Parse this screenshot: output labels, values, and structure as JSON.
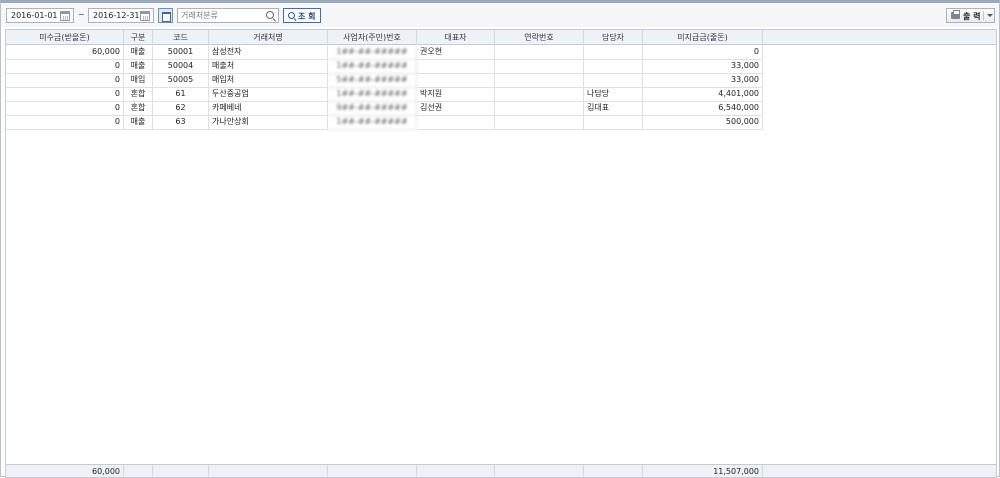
{
  "toolbar": {
    "date_from": "2016-01-01",
    "separator": "~",
    "date_to": "2016-12-31",
    "search_placeholder": "거래처분류",
    "query_label": "조 회",
    "print_label": "출 력"
  },
  "table": {
    "columns": [
      "미수금(받을돈)",
      "구분",
      "코드",
      "거래처명",
      "사업자(주민)번호",
      "대표자",
      "연락번호",
      "담당자",
      "미지급금(줄돈)"
    ],
    "rows": [
      {
        "receivable": "60,000",
        "type": "매출",
        "code": "50001",
        "name": "삼성전자",
        "bizno": "1##-##-#####",
        "ceo": "권오현",
        "phone": "",
        "manager": "",
        "payable": "0"
      },
      {
        "receivable": "0",
        "type": "매출",
        "code": "50004",
        "name": "매출처",
        "bizno": "1##-##-#####",
        "ceo": "",
        "phone": "",
        "manager": "",
        "payable": "33,000"
      },
      {
        "receivable": "0",
        "type": "매입",
        "code": "50005",
        "name": "매입처",
        "bizno": "5##-##-#####",
        "ceo": "",
        "phone": "",
        "manager": "",
        "payable": "33,000"
      },
      {
        "receivable": "0",
        "type": "혼합",
        "code": "61",
        "name": "두산중공업",
        "bizno": "1##-##-#####",
        "ceo": "박지원",
        "phone": "",
        "manager": "나담당",
        "payable": "4,401,000"
      },
      {
        "receivable": "0",
        "type": "혼합",
        "code": "62",
        "name": "카페베네",
        "bizno": "9##-##-#####",
        "ceo": "김선권",
        "phone": "",
        "manager": "김대표",
        "payable": "6,540,000"
      },
      {
        "receivable": "0",
        "type": "매출",
        "code": "63",
        "name": "가나안상회",
        "bizno": "1##-##-#####",
        "ceo": "",
        "phone": "",
        "manager": "",
        "payable": "500,000"
      }
    ],
    "footer": {
      "receivable_total": "60,000",
      "payable_total": "11,507,000"
    }
  }
}
